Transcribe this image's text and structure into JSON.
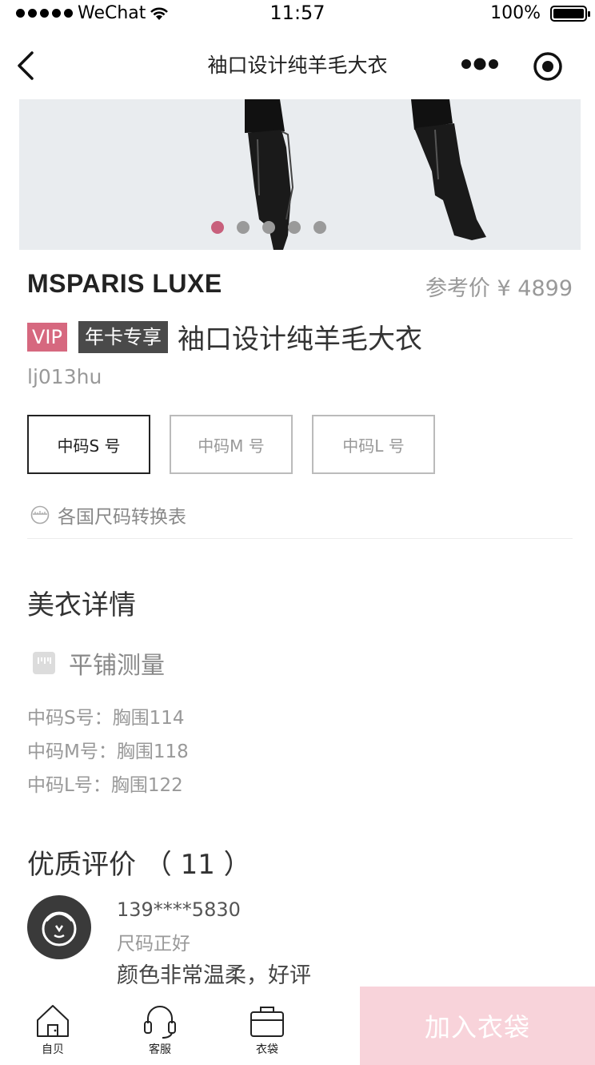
{
  "status_bar": {
    "carrier": "WeChat",
    "time": "11:57",
    "battery": "100%"
  },
  "nav": {
    "title": "袖口设计纯羊毛大衣"
  },
  "carousel": {
    "slides": 5,
    "active": 1
  },
  "product": {
    "brand": "MSPARIS LUXE",
    "ref_price": "参考价 ¥ 4899",
    "vip_tag": "VIP",
    "year_tag": "年卡专享",
    "title": "袖口设计纯羊毛大衣",
    "sku": "lj013hu"
  },
  "sizes": [
    {
      "label": "中码S 号",
      "selected": true
    },
    {
      "label": "中码M 号",
      "selected": false
    },
    {
      "label": "中码L 号",
      "selected": false
    }
  ],
  "size_chart_link": "各国尺码转换表",
  "details": {
    "title": "美衣详情",
    "measure_label": "平铺测量",
    "lines": [
      "中码S号：胸围114",
      "中码M号：胸围118",
      "中码L号：胸围122"
    ]
  },
  "reviews": {
    "title": "优质评价 （ 11 ）",
    "items": [
      {
        "user": "139****5830",
        "fit": "尺码正好",
        "text": "颜色非常温柔，好评"
      }
    ]
  },
  "tabbar": {
    "home": "自贝",
    "service": "客服",
    "bag": "衣袋",
    "add_to_bag": "加入衣袋"
  },
  "colors": {
    "accent": "#d6687f",
    "cart_button": "#f8d3da",
    "dark_tag": "#4a4a4a"
  }
}
